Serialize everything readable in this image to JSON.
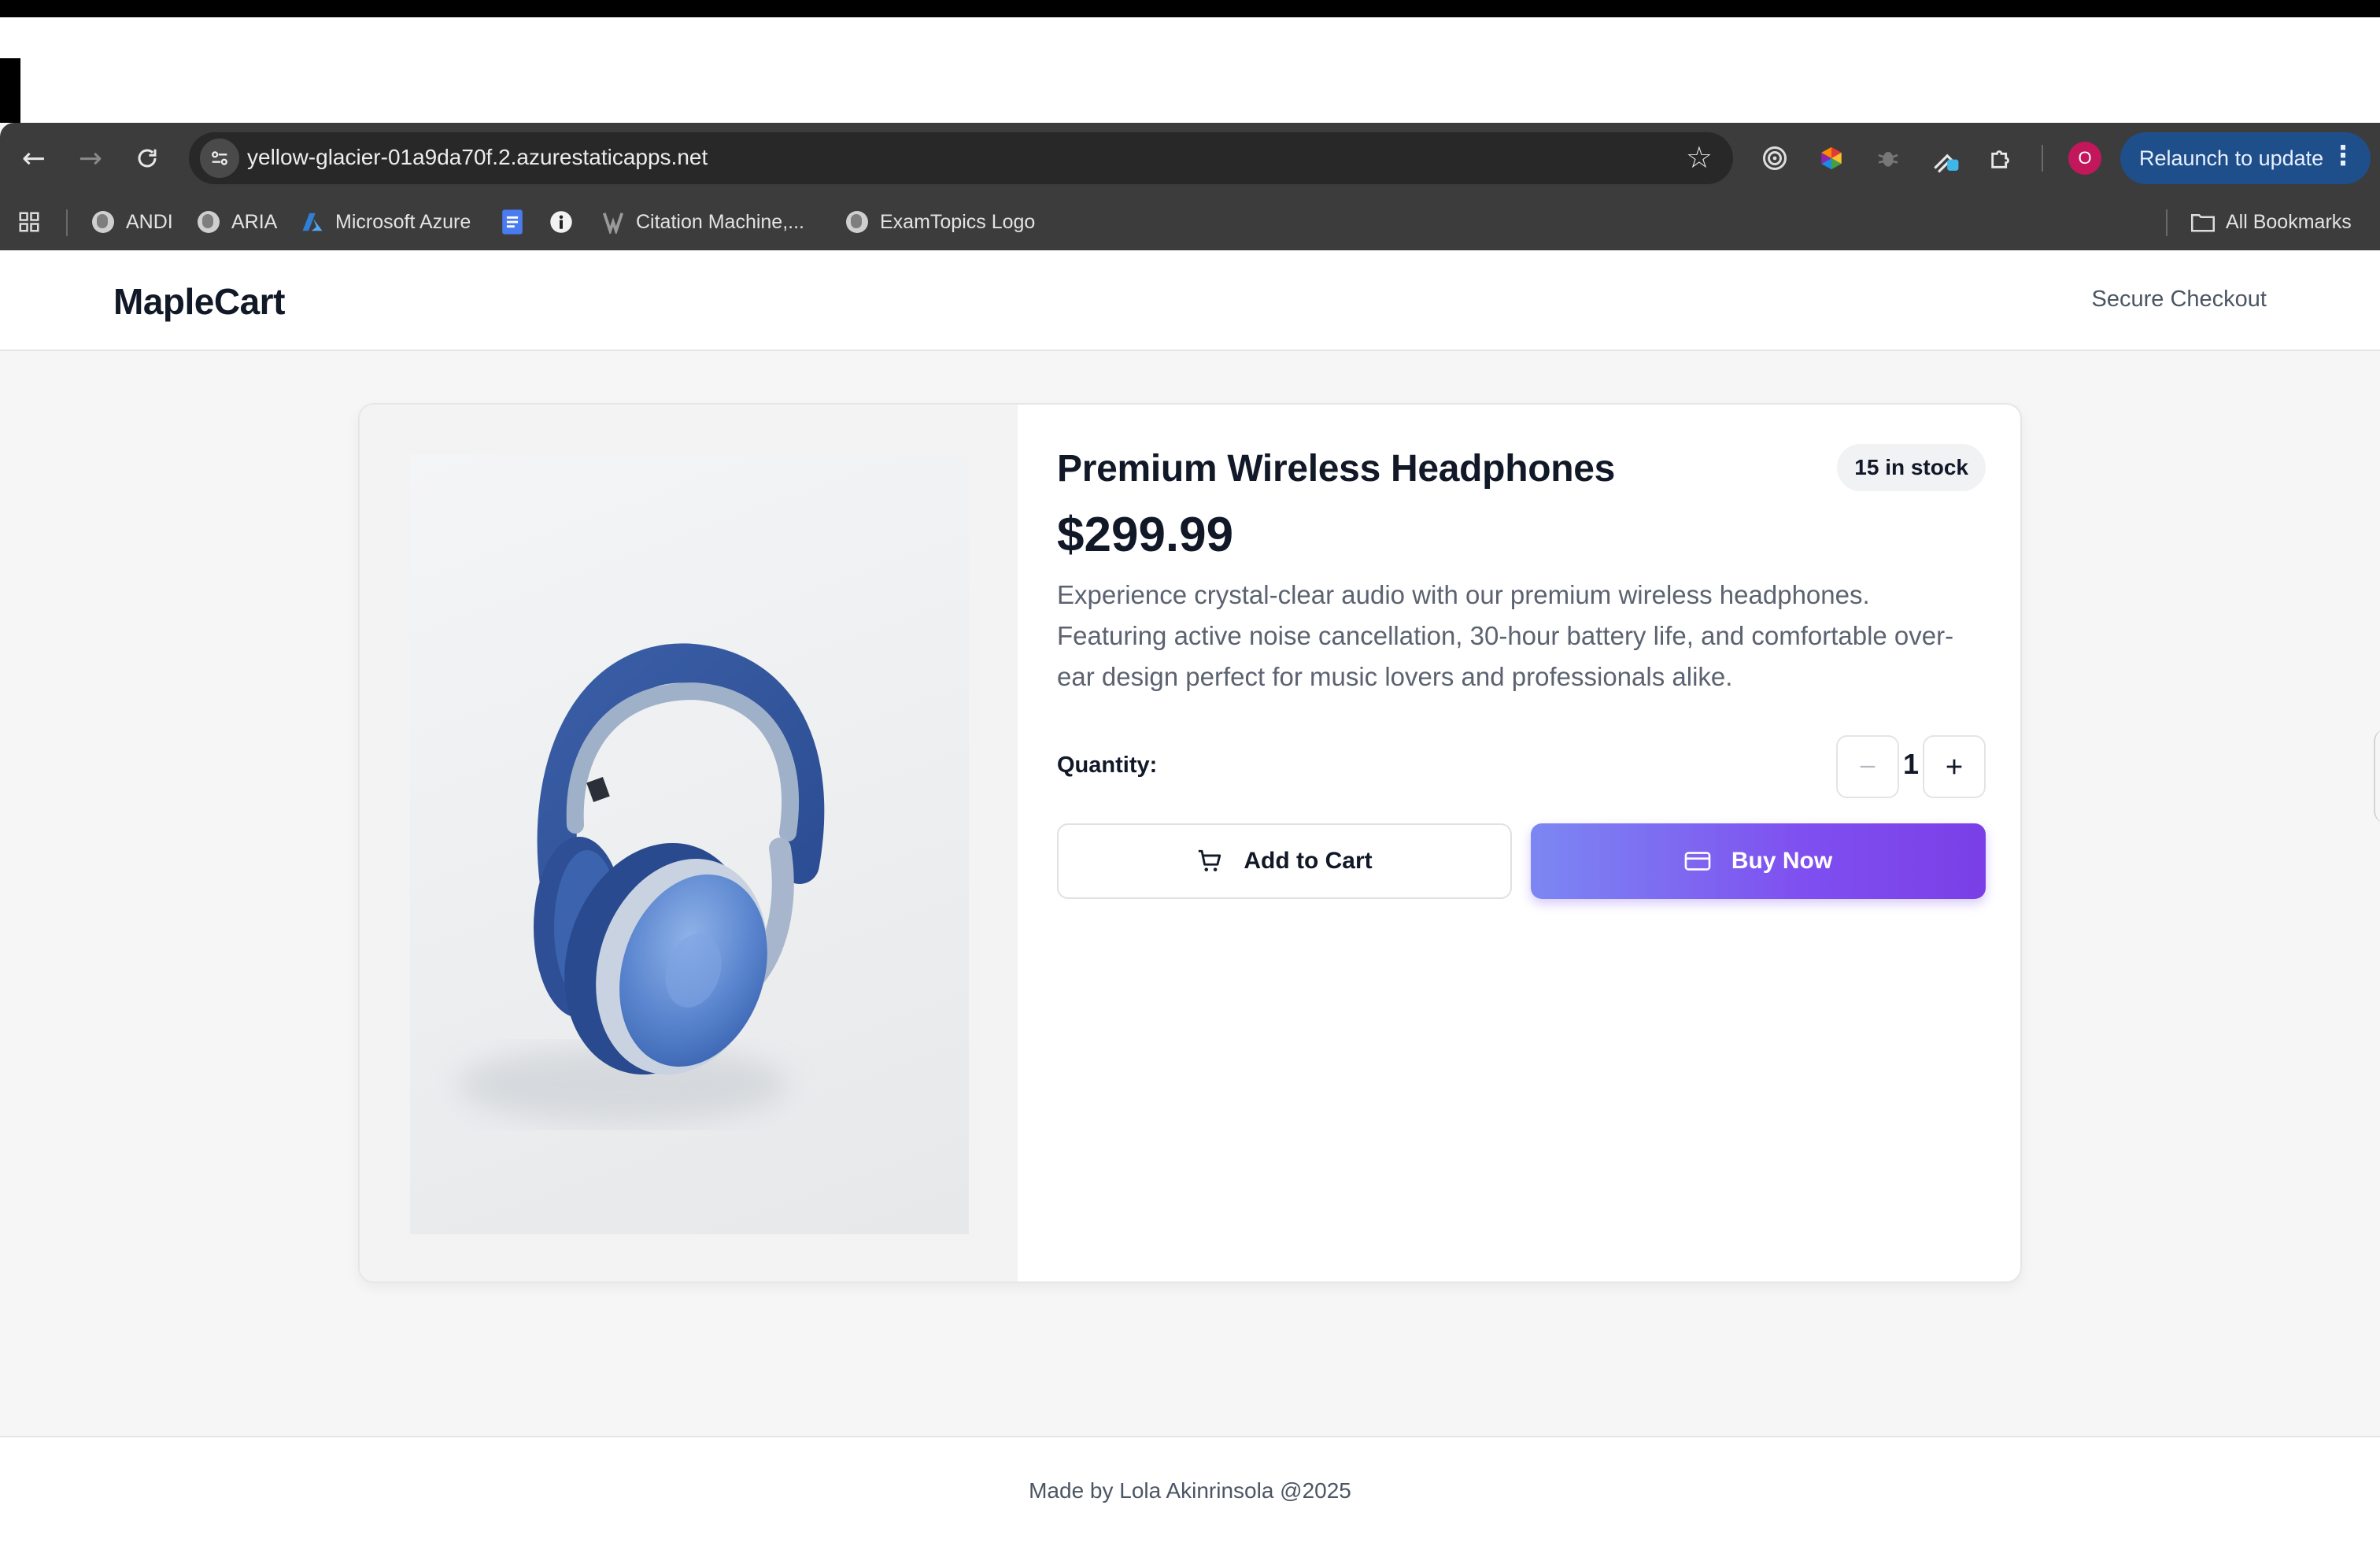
{
  "browser": {
    "url": "yellow-glacier-01a9da70f.2.azurestaticapps.net",
    "profile_initial": "O",
    "relaunch_label": "Relaunch to update",
    "bookmarks": [
      {
        "label": "ANDI",
        "icon": "globe-icon"
      },
      {
        "label": "ARIA",
        "icon": "globe-icon"
      },
      {
        "label": "Microsoft Azure",
        "icon": "azure-icon"
      },
      {
        "label": "",
        "icon": "docs-icon"
      },
      {
        "label": "",
        "icon": "info-icon"
      },
      {
        "label": "Citation Machine,...",
        "icon": "citation-icon"
      },
      {
        "label": "ExamTopics Logo",
        "icon": "globe-icon"
      }
    ],
    "all_bookmarks_label": "All Bookmarks"
  },
  "site": {
    "brand": "MapleCart",
    "secure_label": "Secure Checkout"
  },
  "product": {
    "title": "Premium Wireless Headphones",
    "stock": "15 in stock",
    "price": "$299.99",
    "description": "Experience crystal-clear audio with our premium wireless headphones. Featuring active noise cancellation, 30-hour battery life, and comfortable over-ear design perfect for music lovers and professionals alike.",
    "quantity_label": "Quantity:",
    "quantity": "1",
    "add_to_cart_label": "Add to Cart",
    "buy_now_label": "Buy Now"
  },
  "footer": {
    "text": "Made by Lola Akinrinsola @2025"
  },
  "colors": {
    "accent_start": "#7c87f2",
    "accent_end": "#7a3fe6",
    "headphone_blue": "#3f68b0",
    "text_primary": "#111827"
  }
}
